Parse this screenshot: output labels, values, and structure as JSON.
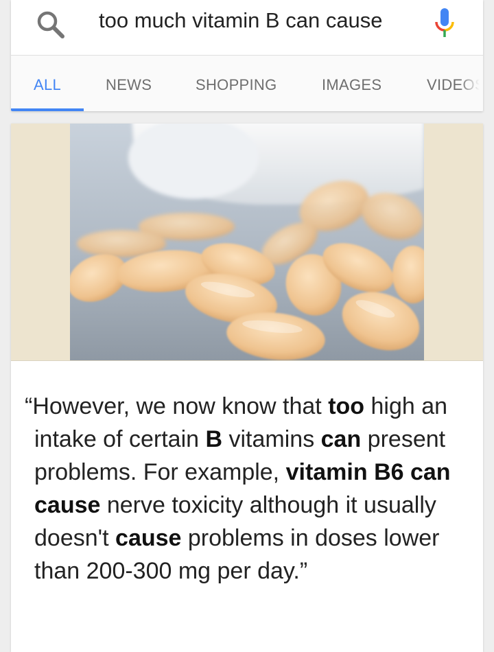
{
  "search": {
    "query": "too much vitamin B can cause",
    "search_icon": "search-icon",
    "mic_icon": "microphone-icon"
  },
  "tabs": [
    {
      "label": "ALL",
      "active": true
    },
    {
      "label": "NEWS",
      "active": false
    },
    {
      "label": "SHOPPING",
      "active": false
    },
    {
      "label": "IMAGES",
      "active": false
    },
    {
      "label": "VIDEOS",
      "active": false
    }
  ],
  "colors": {
    "accent": "#4285f4",
    "image_band": "#ede4cf",
    "pill": "#f0c896"
  },
  "result": {
    "image": "vitamin-pills-photo",
    "snippet_segments": [
      {
        "text": "“However, we now know that ",
        "bold": false
      },
      {
        "text": "too",
        "bold": true
      },
      {
        "text": " high an intake of certain ",
        "bold": false
      },
      {
        "text": "B",
        "bold": true
      },
      {
        "text": " vitamins ",
        "bold": false
      },
      {
        "text": "can",
        "bold": true
      },
      {
        "text": " present problems. For example, ",
        "bold": false
      },
      {
        "text": "vitamin B6 can cause",
        "bold": true
      },
      {
        "text": " nerve toxicity although it usually doesn't ",
        "bold": false
      },
      {
        "text": "cause",
        "bold": true
      },
      {
        "text": " problems in doses lower than 200-300 mg per day.”",
        "bold": false
      }
    ]
  }
}
